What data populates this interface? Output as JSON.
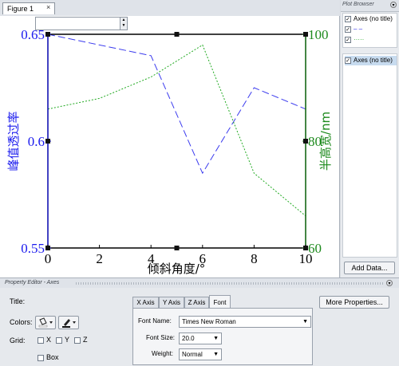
{
  "figure_tab": {
    "label": "Figure 1",
    "close": "×"
  },
  "plot_browser": {
    "title": "Plot Browser",
    "control": "▾",
    "items_top": [
      {
        "label": "Axes (no title)",
        "checked": true
      },
      {
        "label": "– –",
        "checked": true,
        "color": "#2222ee"
      },
      {
        "label": "·····",
        "checked": true,
        "color": "#22aa22"
      }
    ],
    "items_bottom": [
      {
        "label": "Axes (no title)",
        "checked": true
      }
    ],
    "add_data": "Add Data..."
  },
  "colors": {
    "left_axis": "#1a1aee",
    "right_axis": "#1d8a1d",
    "blue_series": "#3b3bee",
    "green_series": "#22aa22"
  },
  "chart_data": {
    "type": "line",
    "xlabel": "倾斜角度/°",
    "ylabel_left": "峰值透过率",
    "ylabel_right": "半高宽/nm",
    "xlim": [
      0,
      10
    ],
    "ylim_left": [
      0.55,
      0.65
    ],
    "ylim_right": [
      60,
      100
    ],
    "x_ticks": [
      "0",
      "2",
      "4",
      "6",
      "8",
      "10"
    ],
    "y_left_ticks": [
      "0.55",
      "0.6",
      "0.65"
    ],
    "y_right_ticks": [
      "60",
      "80",
      "100"
    ],
    "grid": false,
    "series": [
      {
        "axis": "left",
        "style": "dashed",
        "color": "#3b3bee",
        "x": [
          0,
          2,
          4,
          6,
          8,
          10
        ],
        "y": [
          0.65,
          0.645,
          0.64,
          0.585,
          0.625,
          0.615
        ]
      },
      {
        "axis": "right",
        "style": "dotted",
        "color": "#22aa22",
        "x": [
          0,
          2,
          4,
          6,
          8,
          10
        ],
        "y": [
          86,
          88,
          92,
          98,
          74,
          66
        ]
      }
    ]
  },
  "property_editor": {
    "title": "Property Editor - Axes",
    "control": "▾",
    "title_label": "Title:",
    "title_value": "",
    "colors_label": "Colors:",
    "grid_label": "Grid:",
    "grid_x": "X",
    "grid_y": "Y",
    "grid_z": "Z",
    "box_label": "Box",
    "tabs": [
      "X Axis",
      "Y Axis",
      "Z Axis",
      "Font"
    ],
    "active_tab": "Font",
    "font_name_label": "Font Name:",
    "font_name_value": "Times New Roman",
    "font_size_label": "Font Size:",
    "font_size_value": "20.0",
    "weight_label": "Weight:",
    "weight_value": "Normal",
    "more_properties": "More Properties..."
  }
}
